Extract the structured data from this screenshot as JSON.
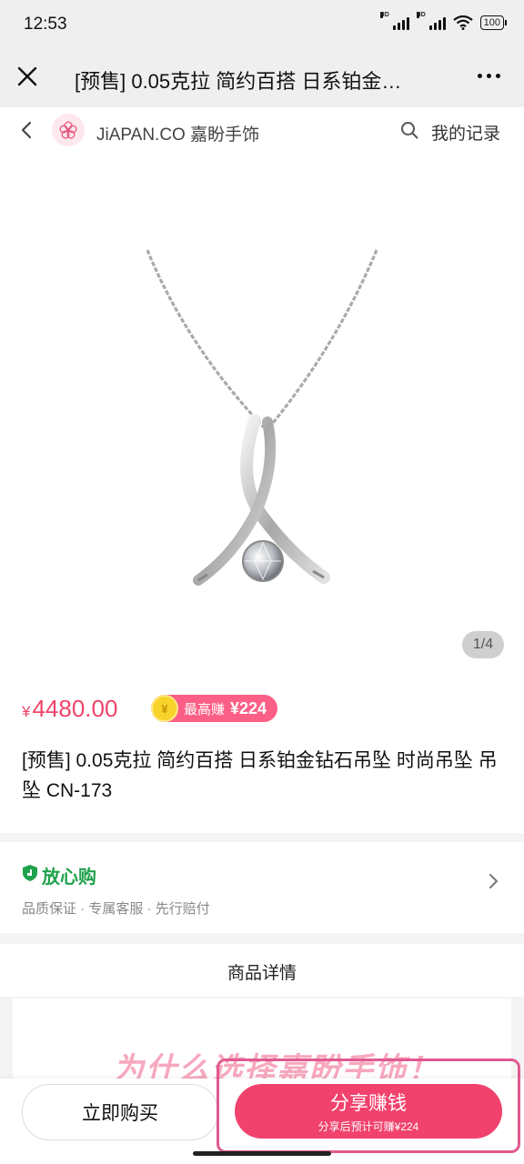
{
  "status_bar": {
    "time": "12:53",
    "signal_label": "HD",
    "battery": "100"
  },
  "title_bar": {
    "title": "[预售] 0.05克拉 简约百搭 日系铂金…"
  },
  "shop": {
    "name": "JiAPAN.CO 嘉盼手饰",
    "record_label": "我的记录"
  },
  "gallery": {
    "indicator": "1/4"
  },
  "product": {
    "currency": "¥",
    "price": "4480.00",
    "earn_coin": "¥",
    "earn_label": "最高赚",
    "earn_amount": "¥224",
    "title": "[预售] 0.05克拉 简约百搭 日系铂金钻石吊坠 时尚吊坠 吊坠 CN-173"
  },
  "guarantee": {
    "title": "放心购",
    "items": "品质保证 · 专属客服 · 先行赔付"
  },
  "details": {
    "title": "商品详情",
    "promo": "为什么选择嘉盼手饰！"
  },
  "bottom_bar": {
    "buy_label": "立即购买",
    "share_label": "分享赚钱",
    "share_sub": "分享后预计可赚¥224"
  },
  "colors": {
    "accent": "#f1426d",
    "price": "#f0446a",
    "green": "#20a24d"
  }
}
